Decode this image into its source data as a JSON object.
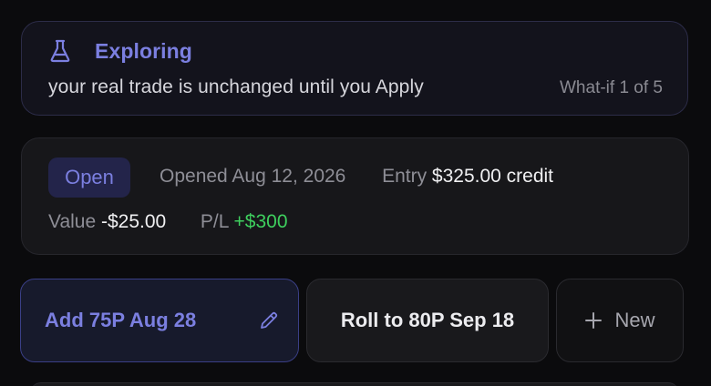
{
  "banner": {
    "icon": "flask-icon",
    "title": "Exploring",
    "description": "your real trade is unchanged until you Apply",
    "scenario_counter": "What-if 1 of 5",
    "accent_color": "#7b7fe0"
  },
  "position": {
    "status": "Open",
    "opened_label": "Opened",
    "opened_date": "Aug 12, 2026",
    "entry_label": "Entry",
    "entry_value": "$325.00 credit",
    "value_label": "Value",
    "value_value": "-$25.00",
    "pl_label": "P/L",
    "pl_value": "+$300",
    "pl_color": "#3ecf5e"
  },
  "actions": {
    "add_label": "Add 75P Aug 28",
    "add_icon": "pencil-icon",
    "roll_label": "Roll to 80P Sep 18",
    "new_label": "New",
    "new_icon": "plus-icon"
  }
}
